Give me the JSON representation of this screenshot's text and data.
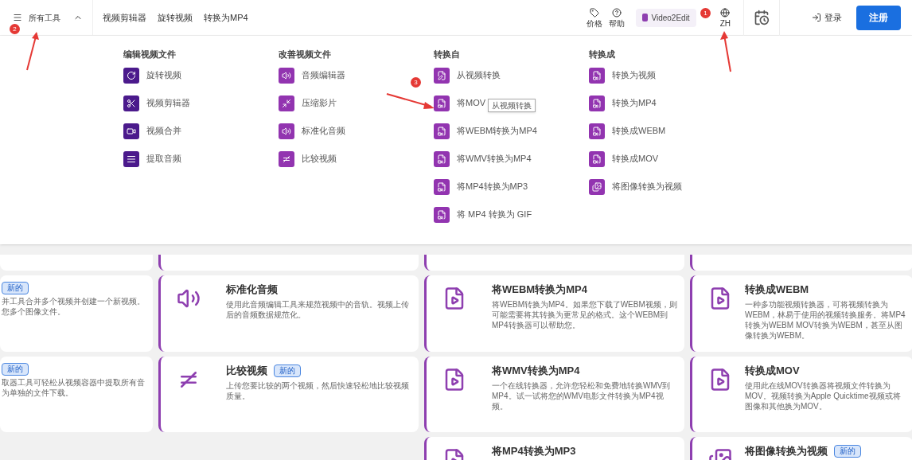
{
  "header": {
    "menu_label": "所有工具",
    "expanded": true,
    "nav_links": [
      "视频剪辑器",
      "旋转视频",
      "转换为MP4"
    ],
    "pricing": "价格",
    "help": "帮助",
    "brand": "Video2Edit",
    "language": "ZH",
    "login": "登录",
    "signup": "注册"
  },
  "mega_menu": {
    "columns": [
      {
        "heading": "编辑视频文件",
        "items": [
          "旋转视频",
          "视频剪辑器",
          "视频合并",
          "提取音频"
        ]
      },
      {
        "heading": "改善视频文件",
        "items": [
          "音频编辑器",
          "压缩影片",
          "标准化音频",
          "比较视频"
        ]
      },
      {
        "heading": "转换自",
        "items": [
          "从视频转换",
          "将MOV",
          "将WEBM转换为MP4",
          "将WMV转换为MP4",
          "将MP4转换为MP3",
          "将 MP4 转换为 GIF"
        ]
      },
      {
        "heading": "转换成",
        "items": [
          "转换为视频",
          "转换为MP4",
          "转换成WEBM",
          "转换成MOV",
          "将图像转换为视频"
        ]
      }
    ],
    "tooltip": "从视频转换"
  },
  "cards": [
    [
      {
        "badge": "新的",
        "description": "并工具合并多个视频并创建一个新视频。您多个图像文件。"
      },
      {
        "title": "标准化音频",
        "description": "使用此音频编辑工具来规范视频中的音轨。视频上传后的音频数据规范化。"
      },
      {
        "title": "将WEBM转换为MP4",
        "description": "将WEBM转换为MP4。如果您下载了WEBM视频，则可能需要将其转换为更常见的格式。这个WEBM到MP4转换器可以帮助您。"
      },
      {
        "title": "转换成WEBM",
        "description": "一种多功能视频转换器，可将视频转换为WEBM，林易于使用的视频转换服务。将MP4转换为WEBM MOV转换为WEBM，甚至从图像转换为WEBM。"
      }
    ],
    [
      {
        "badge": "新的",
        "description": "取器工具可轻松从视频容器中提取所有音为单独的文件下载。"
      },
      {
        "title": "比较视频",
        "badge": "新的",
        "description": "上传您要比较的两个视频，然后快速轻松地比较视频质量。"
      },
      {
        "title": "将WMV转换为MP4",
        "description": "一个在线转换器，允许您轻松和免费地转换WMV到MP4。试一试将您的WMV电影文件转换为MP4视频。"
      },
      {
        "title": "转换成MOV",
        "description": "使用此在线MOV转换器将视频文件转换为MOV。视频转换为Apple Quicktime视频或将图像和其他换为MOV。"
      }
    ],
    [
      {
        "title": "将MP4转换为MP3"
      },
      {
        "title": "将图像转换为视频",
        "badge": "新的"
      }
    ]
  ],
  "annotations": [
    {
      "number": "2"
    },
    {
      "number": "1"
    },
    {
      "number": "3"
    }
  ]
}
